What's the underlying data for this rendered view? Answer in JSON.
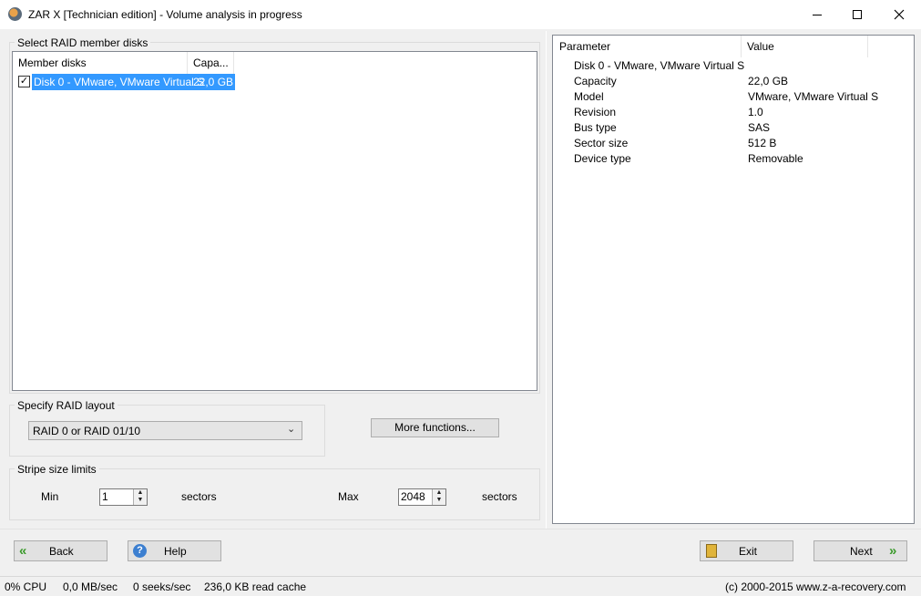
{
  "window": {
    "title": "ZAR X  [Technician edition] - Volume analysis in progress"
  },
  "raid_members": {
    "group_title": "Select RAID member disks",
    "columns": [
      "Member disks",
      "Capa..."
    ],
    "rows": [
      {
        "name": "Disk 0 - VMware, VMware Virtual S",
        "capacity": "22,0 GB",
        "checked": true,
        "selected": true
      }
    ]
  },
  "raid_layout": {
    "group_title": "Specify RAID layout",
    "selected": "RAID 0 or RAID 01/10"
  },
  "more_functions_label": "More functions...",
  "stripe": {
    "group_title": "Stripe size limits",
    "min_label": "Min",
    "min_value": "1",
    "max_label": "Max",
    "max_value": "2048",
    "unit": "sectors"
  },
  "params": {
    "columns": [
      "Parameter",
      "Value"
    ],
    "header_row": "Disk 0 - VMware, VMware Virtual S",
    "rows": [
      {
        "name": "Capacity",
        "value": "22,0 GB"
      },
      {
        "name": "Model",
        "value": "VMware, VMware Virtual S"
      },
      {
        "name": "Revision",
        "value": "1.0"
      },
      {
        "name": "Bus type",
        "value": "SAS"
      },
      {
        "name": "Sector size",
        "value": "512 B"
      },
      {
        "name": "Device type",
        "value": "Removable"
      }
    ]
  },
  "nav": {
    "back": "Back",
    "help": "Help",
    "exit": "Exit",
    "next": "Next"
  },
  "status": {
    "cpu": "0% CPU",
    "throughput": "0,0 MB/sec",
    "seeks": "0 seeks/sec",
    "cache": "236,0 KB read cache",
    "copyright": "(c) 2000-2015 www.z-a-recovery.com"
  }
}
